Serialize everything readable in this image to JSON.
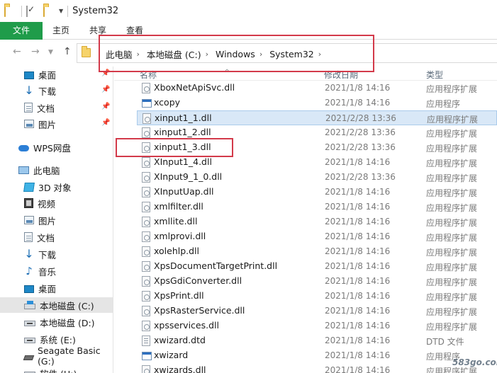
{
  "window": {
    "title": "System32"
  },
  "ribbon": {
    "tabs": [
      {
        "label": "文件"
      },
      {
        "label": "主页"
      },
      {
        "label": "共享"
      },
      {
        "label": "查看"
      }
    ]
  },
  "address": {
    "crumbs": [
      "此电脑",
      "本地磁盘 (C:)",
      "Windows",
      "System32"
    ]
  },
  "nav": {
    "items": [
      {
        "label": "桌面",
        "icon": "desktop-icon",
        "pinned": true
      },
      {
        "label": "下载",
        "icon": "download-icon",
        "pinned": true
      },
      {
        "label": "文档",
        "icon": "document-icon",
        "pinned": true
      },
      {
        "label": "图片",
        "icon": "picture-icon",
        "pinned": true
      },
      {
        "label": "WPS网盘",
        "icon": "cloud-icon"
      },
      {
        "label": "此电脑",
        "icon": "computer-icon"
      },
      {
        "label": "3D 对象",
        "icon": "3d-objects-icon"
      },
      {
        "label": "视频",
        "icon": "video-icon"
      },
      {
        "label": "图片",
        "icon": "picture-icon"
      },
      {
        "label": "文档",
        "icon": "document-icon"
      },
      {
        "label": "下载",
        "icon": "download-icon"
      },
      {
        "label": "音乐",
        "icon": "music-icon"
      },
      {
        "label": "桌面",
        "icon": "desktop-icon"
      },
      {
        "label": "本地磁盘 (C:)",
        "icon": "system-drive-icon",
        "selected": true
      },
      {
        "label": "本地磁盘 (D:)",
        "icon": "drive-icon"
      },
      {
        "label": "系统 (E:)",
        "icon": "drive-icon"
      },
      {
        "label": "Seagate Basic (G:)",
        "icon": "external-drive-icon"
      },
      {
        "label": "软件 (H:)",
        "icon": "drive-icon"
      }
    ]
  },
  "columns": {
    "name": "名称",
    "date": "修改日期",
    "type": "类型"
  },
  "files": [
    {
      "name": "XboxNetApiSvc.dll",
      "date": "2021/1/8 14:16",
      "type": "应用程序扩展",
      "icon": "dll-icon"
    },
    {
      "name": "xcopy",
      "date": "2021/1/8 14:16",
      "type": "应用程序",
      "icon": "exe-icon"
    },
    {
      "name": "xinput1_1.dll",
      "date": "2021/2/28 13:36",
      "type": "应用程序扩展",
      "icon": "dll-icon",
      "selected": true
    },
    {
      "name": "xinput1_2.dll",
      "date": "2021/2/28 13:36",
      "type": "应用程序扩展",
      "icon": "dll-icon"
    },
    {
      "name": "xinput1_3.dll",
      "date": "2021/2/28 13:36",
      "type": "应用程序扩展",
      "icon": "dll-icon"
    },
    {
      "name": "XInput1_4.dll",
      "date": "2021/1/8 14:16",
      "type": "应用程序扩展",
      "icon": "dll-icon"
    },
    {
      "name": "XInput9_1_0.dll",
      "date": "2021/2/28 13:36",
      "type": "应用程序扩展",
      "icon": "dll-icon"
    },
    {
      "name": "XInputUap.dll",
      "date": "2021/1/8 14:16",
      "type": "应用程序扩展",
      "icon": "dll-icon"
    },
    {
      "name": "xmlfilter.dll",
      "date": "2021/1/8 14:16",
      "type": "应用程序扩展",
      "icon": "dll-icon",
      "hover": true
    },
    {
      "name": "xmllite.dll",
      "date": "2021/1/8 14:16",
      "type": "应用程序扩展",
      "icon": "dll-icon"
    },
    {
      "name": "xmlprovi.dll",
      "date": "2021/1/8 14:16",
      "type": "应用程序扩展",
      "icon": "dll-icon"
    },
    {
      "name": "xolehlp.dll",
      "date": "2021/1/8 14:16",
      "type": "应用程序扩展",
      "icon": "dll-icon"
    },
    {
      "name": "XpsDocumentTargetPrint.dll",
      "date": "2021/1/8 14:16",
      "type": "应用程序扩展",
      "icon": "dll-icon"
    },
    {
      "name": "XpsGdiConverter.dll",
      "date": "2021/1/8 14:16",
      "type": "应用程序扩展",
      "icon": "dll-icon"
    },
    {
      "name": "XpsPrint.dll",
      "date": "2021/1/8 14:16",
      "type": "应用程序扩展",
      "icon": "dll-icon"
    },
    {
      "name": "XpsRasterService.dll",
      "date": "2021/1/8 14:16",
      "type": "应用程序扩展",
      "icon": "dll-icon"
    },
    {
      "name": "xpsservices.dll",
      "date": "2021/1/8 14:16",
      "type": "应用程序扩展",
      "icon": "dll-icon"
    },
    {
      "name": "xwizard.dtd",
      "date": "2021/1/8 14:16",
      "type": "DTD 文件",
      "icon": "dtd-icon"
    },
    {
      "name": "xwizard",
      "date": "2021/1/8 14:16",
      "type": "应用程序",
      "icon": "exe-icon"
    },
    {
      "name": "xwizards.dll",
      "date": "2021/1/8 14:16",
      "type": "应用程序扩展",
      "icon": "dll-icon"
    }
  ],
  "watermark": {
    "text": "583go.com"
  },
  "colors": {
    "file_tab": "#1f9c4a",
    "selection": "#d9e8f7",
    "annotation": "#d33a4a"
  }
}
